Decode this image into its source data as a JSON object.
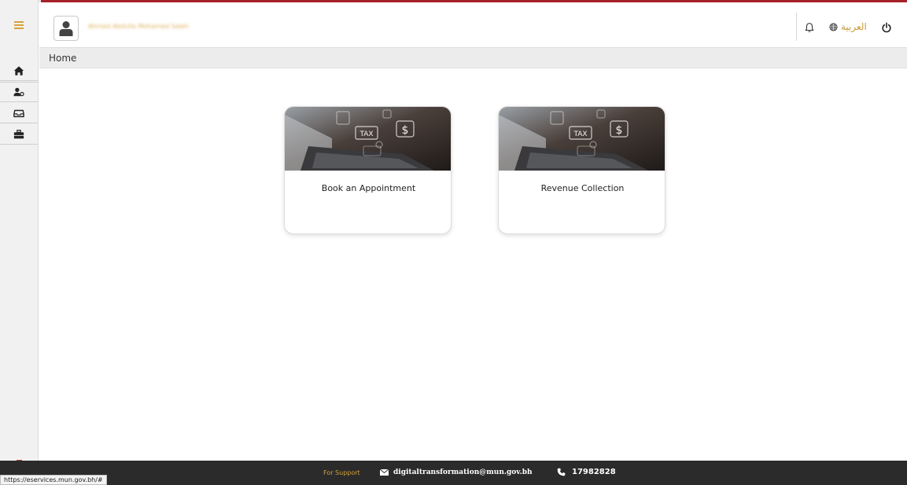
{
  "header": {
    "user_name": "Ahmed Abdulla Mohamed Saleh",
    "language_label": "العربية"
  },
  "breadcrumb": {
    "current": "Home"
  },
  "cards": [
    {
      "title": "Book an Appointment",
      "image_text": "TAX"
    },
    {
      "title": "Revenue Collection",
      "image_text": "TAX"
    }
  ],
  "footer": {
    "support_label": "For Support",
    "email": "digitaltransformation@mun.gov.bh",
    "phone": "17982828"
  },
  "status_bar": {
    "url": "https://eservices.mun.gov.bh/#"
  },
  "icons": [
    "hamburger-icon",
    "home-icon",
    "user-settings-icon",
    "inbox-icon",
    "briefcase-icon",
    "user-icon",
    "bell-icon",
    "globe-icon",
    "power-icon",
    "mail-icon",
    "phone-icon"
  ],
  "colors": {
    "accent": "#a6202a",
    "gold": "#d4a23a",
    "footer_bg": "#2b2b2b"
  }
}
